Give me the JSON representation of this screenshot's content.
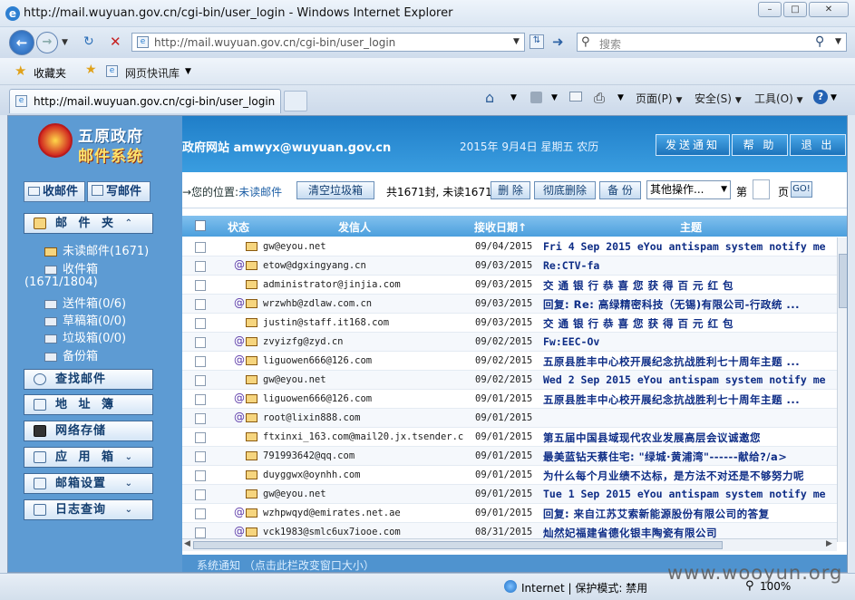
{
  "window": {
    "title": "http://mail.wuyuan.gov.cn/cgi-bin/user_login - Windows Internet Explorer",
    "url": "http://mail.wuyuan.gov.cn/cgi-bin/user_login",
    "search_placeholder": "搜索",
    "favorites_label": "收藏夹",
    "web_slice_label": "网页快讯库",
    "tab_title": "http://mail.wuyuan.gov.cn/cgi-bin/user_login",
    "cmd_page": "页面(P)",
    "cmd_safety": "安全(S)",
    "cmd_tools": "工具(O)",
    "cmd_help": "?"
  },
  "sidebar": {
    "logo_line1": "五原政府",
    "logo_line2": "邮件系统",
    "receive_button": "收邮件",
    "compose_button": "写邮件",
    "folders_header": "邮 件 夹",
    "folders": [
      {
        "label": "未读邮件(1671)"
      },
      {
        "label": "收件箱"
      },
      {
        "label": "(1671/1804)"
      },
      {
        "label": "送件箱(0/6)"
      },
      {
        "label": "草稿箱(0/0)"
      },
      {
        "label": "垃圾箱(0/0)"
      },
      {
        "label": "备份箱"
      }
    ],
    "search_mail": "查找邮件",
    "address_book": "地 址 簿",
    "net_storage": "网络存储",
    "app_box": "应 用 箱",
    "mail_settings": "邮箱设置",
    "log_query": "日志查询"
  },
  "header": {
    "account": "政府网站  amwyx@wuyuan.gov.cn",
    "date": "2015年 9月4日 星期五 农历",
    "notify_button": "发送通知",
    "help_button": "帮 助",
    "logout_button": "退 出"
  },
  "toolbar": {
    "location_prefix": "→您的位置:",
    "location_value": "未读邮件",
    "clear_trash": "清空垃圾箱",
    "count_text": "共1671封, 未读1671封",
    "delete": "删 除",
    "delete_perm": "彻底删除",
    "backup": "备 份",
    "more_ops": "其他操作...",
    "page_prefix": "第",
    "page_suffix": "页",
    "go": "GO!"
  },
  "table": {
    "col_status": "状态",
    "col_sender": "发信人",
    "col_date": "接收日期↑",
    "col_subject": "主题",
    "rows": [
      {
        "att": "",
        "from": "gw@eyou.net",
        "date": "09/04/2015",
        "subject": "Fri  4 Sep 2015 eYou antispam system notify me",
        "cjk": false
      },
      {
        "att": "@",
        "from": "etow@dgxingyang.cn",
        "date": "09/03/2015",
        "subject": "Re:CTV-fa",
        "cjk": false
      },
      {
        "att": "",
        "from": "administrator@jinjia.com",
        "date": "09/03/2015",
        "subject": "交 通 银 行 恭 喜 您 获 得 百 元 红 包",
        "cjk": true
      },
      {
        "att": "@",
        "from": "wrzwhb@zdlaw.com.cn",
        "date": "09/03/2015",
        "subject": "回复: Re: 高绿精密科技（无锡)有限公司-行政统 ...",
        "cjk": true
      },
      {
        "att": "",
        "from": "justin@staff.it168.com",
        "date": "09/03/2015",
        "subject": "交 通 银 行 恭 喜 您 获 得 百 元 红 包",
        "cjk": true
      },
      {
        "att": "@",
        "from": "zvyizfg@zyd.cn",
        "date": "09/02/2015",
        "subject": "Fw:EEC-Ov",
        "cjk": false
      },
      {
        "att": "@",
        "from": "liguowen666@126.com",
        "date": "09/02/2015",
        "subject": "五原县胜丰中心校开展纪念抗战胜利七十周年主题 ...",
        "cjk": true
      },
      {
        "att": "",
        "from": "gw@eyou.net",
        "date": "09/02/2015",
        "subject": "Wed  2 Sep 2015 eYou antispam system notify me",
        "cjk": false
      },
      {
        "att": "@",
        "from": "liguowen666@126.com",
        "date": "09/01/2015",
        "subject": "五原县胜丰中心校开展纪念抗战胜利七十周年主题 ...",
        "cjk": true
      },
      {
        "att": "@",
        "from": "root@lixin888.com",
        "date": "09/01/2015",
        "subject": "",
        "cjk": false
      },
      {
        "att": "",
        "from": "ftxinxi_163.com@mail20.jx.tsender.com",
        "date": "09/01/2015",
        "subject": "第五届中国县域现代农业发展高层会议诚邀您",
        "cjk": true
      },
      {
        "att": "",
        "from": "791993642@qq.com",
        "date": "09/01/2015",
        "subject": "最美蓝钻天蔡住宅: \"绿城·黄浦湾\"------献给?/a>",
        "cjk": true
      },
      {
        "att": "",
        "from": "duyggwx@oynhh.com",
        "date": "09/01/2015",
        "subject": "为什么每个月业绩不达标，是方法不对还是不够努力呢",
        "cjk": true
      },
      {
        "att": "",
        "from": "gw@eyou.net",
        "date": "09/01/2015",
        "subject": "Tue  1 Sep 2015 eYou antispam system notify me",
        "cjk": false
      },
      {
        "att": "@",
        "from": "wzhpwqyd@emirates.net.ae",
        "date": "09/01/2015",
        "subject": "回复: 来自江苏艾索新能源股份有限公司的答复",
        "cjk": true
      },
      {
        "att": "@",
        "from": "vck1983@smlc6ux7iooe.com",
        "date": "08/31/2015",
        "subject": "灿然妃福建省德化银丰陶瓷有限公司",
        "cjk": true
      }
    ]
  },
  "notice": "系统通知 （点击此栏改变窗口大小）",
  "status": {
    "zone": "Internet | 保护模式: 禁用",
    "zoom": "100%"
  },
  "watermark": "www.wooyun.org"
}
